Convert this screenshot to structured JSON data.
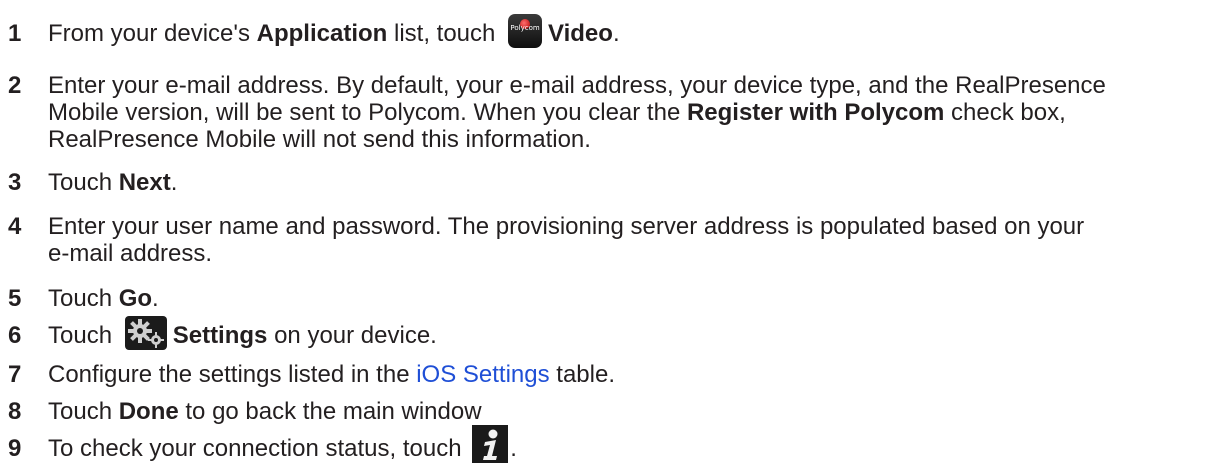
{
  "steps": [
    {
      "num": "1",
      "a": "From your device's ",
      "b": "Application",
      "c": " list, touch ",
      "icon_label": "Polycom",
      "d": "Video",
      "e": "."
    },
    {
      "num": "2",
      "l1": "Enter your e-mail address. By default, your e-mail address, your device type, and the RealPresence",
      "l2a": "Mobile version, will be sent to Polycom. When you clear the ",
      "l2b": "Register with Polycom",
      "l2c": " check box,",
      "l3": "RealPresence Mobile will not send this information."
    },
    {
      "num": "3",
      "a": "Touch ",
      "b": "Next",
      "c": "."
    },
    {
      "num": "4",
      "l1": "Enter your user name and password. The provisioning server address is populated based on your",
      "l2": "e-mail address."
    },
    {
      "num": "5",
      "a": "Touch ",
      "b": "Go",
      "c": "."
    },
    {
      "num": "6",
      "a": "Touch ",
      "b": "Settings",
      "c": " on your device."
    },
    {
      "num": "7",
      "a": "Configure the settings listed in the ",
      "link": "iOS Settings",
      "c": " table."
    },
    {
      "num": "8",
      "a": "Touch ",
      "b": "Done",
      "c": " to go back the main window"
    },
    {
      "num": "9",
      "a": "To check your connection status, touch ",
      "c": "."
    }
  ],
  "icons": {
    "video": "polycom-video-app-icon",
    "settings": "gears-icon",
    "info": "info-icon"
  },
  "colors": {
    "text": "#231f20",
    "link": "#1f4fd6"
  }
}
